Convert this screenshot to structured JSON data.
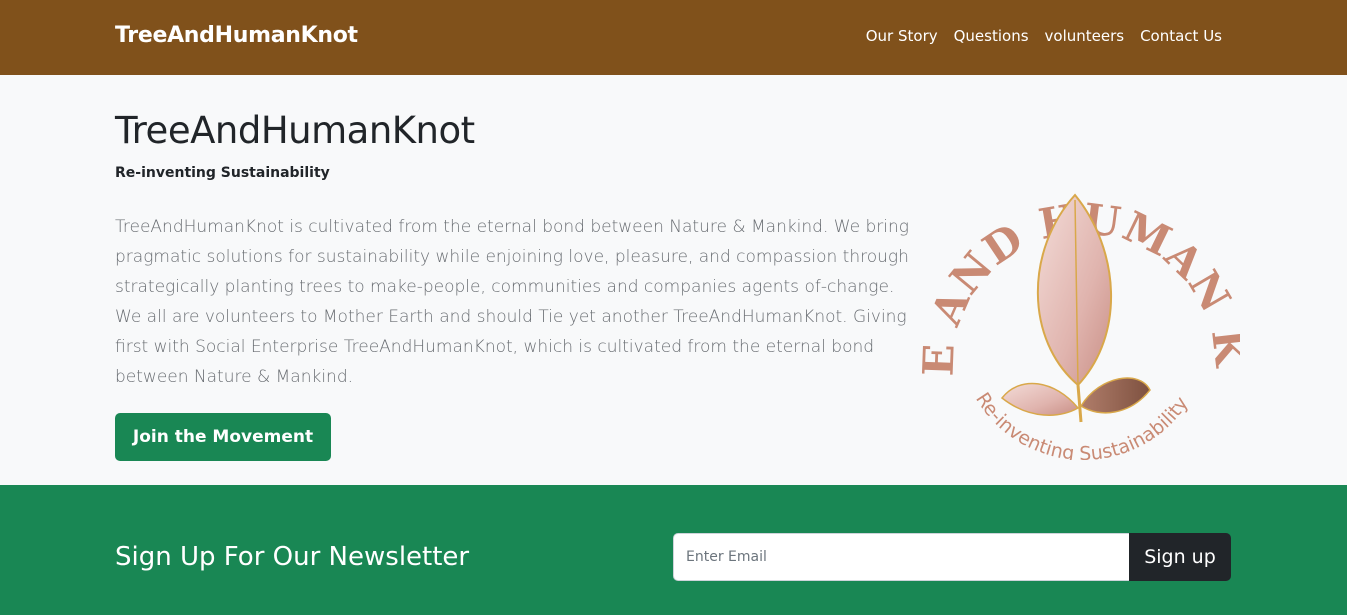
{
  "navbar": {
    "brand": "TreeAndHumanKnot",
    "links": [
      "Our Story",
      "Questions",
      "volunteers",
      "Contact Us"
    ]
  },
  "hero": {
    "title": "TreeAndHumanKnot",
    "subtitle": "Re-inventing Sustainability",
    "description": "TreeAndHumanKnot is cultivated from the eternal bond between Nature & Mankind. We bring pragmatic solutions for sustainability while enjoining love, pleasure, and compassion through strategically planting trees to make-people, communities and companies agents of-change. We all are volunteers to Mother Earth and should Tie yet another TreeAndHumanKnot. Giving first with Social Enterprise TreeAndHumanKnot, which is cultivated from the eternal bond between Nature & Mankind.",
    "button_label": "Join the Movement"
  },
  "logo": {
    "arc_text": "TREE AND HUMAN KNOT",
    "tagline": "Re-inventing Sustainability",
    "colors": {
      "arc": "#c98a74",
      "leaf": "#e8c3c0",
      "leaf_dark": "#a86f5c",
      "outline": "#d9a84a"
    }
  },
  "newsletter": {
    "title": "Sign Up For Our Newsletter",
    "email_placeholder": "Enter Email",
    "button_label": "Sign up"
  },
  "colors": {
    "navbar_bg": "#80511b",
    "hero_bg": "#f8f9fa",
    "primary_green": "#198754",
    "dark_button": "#212529"
  }
}
